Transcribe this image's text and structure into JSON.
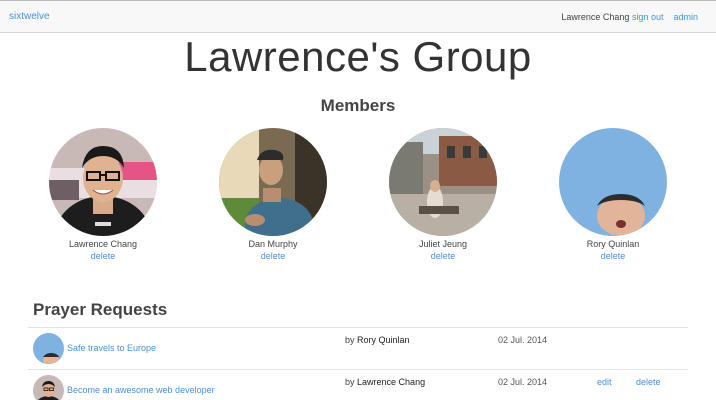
{
  "nav": {
    "brand": "sixtwelve",
    "user": "Lawrence Chang",
    "sign_out": "sign out",
    "admin": "admin"
  },
  "page": {
    "title": "Lawrence's Group",
    "members_heading": "Members",
    "prayer_heading": "Prayer Requests"
  },
  "members": [
    {
      "name": "Lawrence Chang",
      "action": "delete"
    },
    {
      "name": "Dan Murphy",
      "action": "delete"
    },
    {
      "name": "Juliet Jeung",
      "action": "delete"
    },
    {
      "name": "Rory Quinlan",
      "action": "delete"
    }
  ],
  "requests": [
    {
      "title": "Safe travels to Europe",
      "by_prefix": "by",
      "author": "Rory Quinlan",
      "date": "02 Jul. 2014"
    },
    {
      "title": "Become an awesome web developer",
      "by_prefix": "by",
      "author": "Lawrence Chang",
      "date": "02 Jul. 2014",
      "edit": "edit",
      "delete": "delete"
    }
  ],
  "colors": {
    "link": "#4a90d9",
    "navbar_bg": "#f8f8f8"
  }
}
